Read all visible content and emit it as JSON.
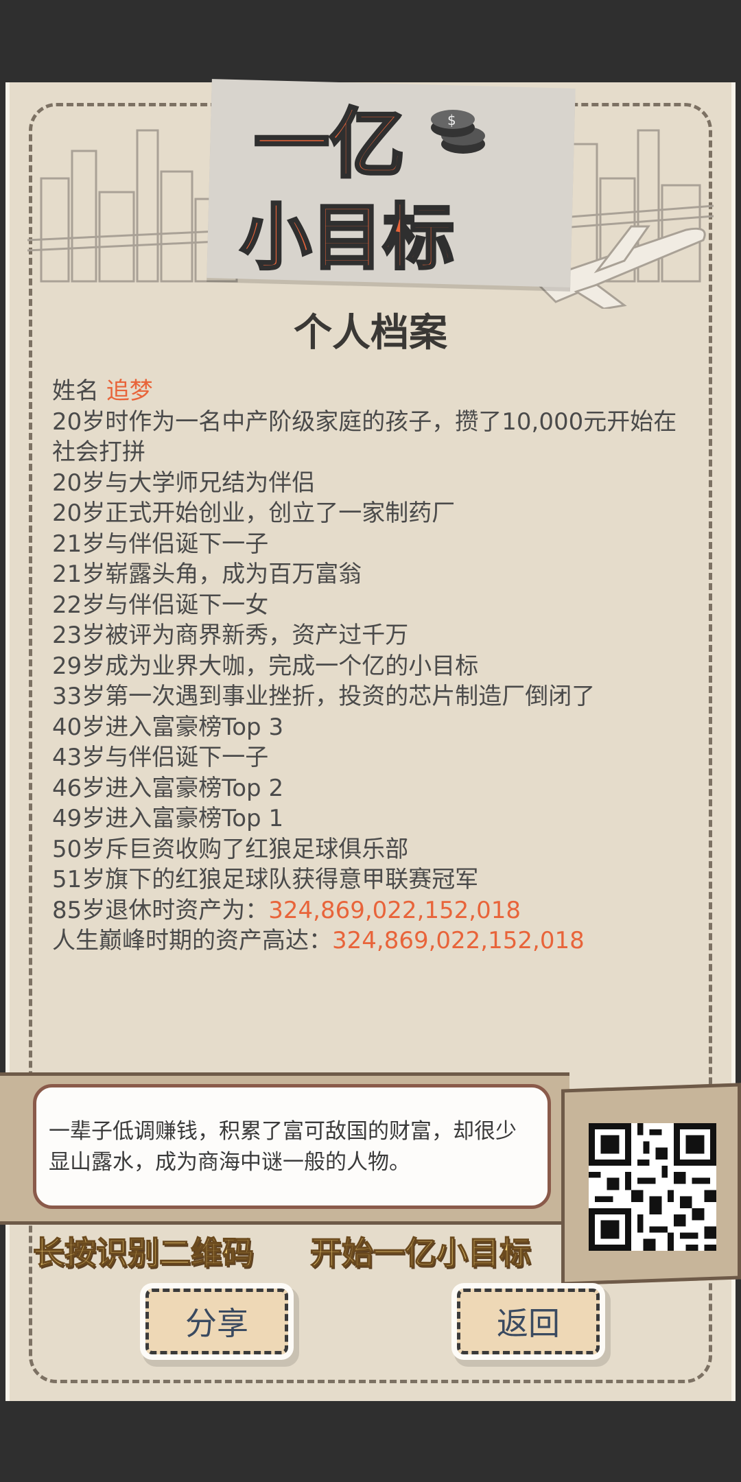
{
  "logo": {
    "line1": "一亿",
    "line2": "小目标"
  },
  "page_title": "个人档案",
  "profile": {
    "name_label": "姓名",
    "name_value": "追梦",
    "events": [
      "20岁时作为一名中产阶级家庭的孩子，攒了10,000元开始在社会打拼",
      "20岁与大学师兄结为伴侣",
      "20岁正式开始创业，创立了一家制药厂",
      "21岁与伴侣诞下一子",
      "21岁崭露头角，成为百万富翁",
      "22岁与伴侣诞下一女",
      "23岁被评为商界新秀，资产过千万",
      "29岁成为业界大咖，完成一个亿的小目标",
      "33岁第一次遇到事业挫折，投资的芯片制造厂倒闭了",
      "40岁进入富豪榜Top 3",
      "43岁与伴侣诞下一子",
      "46岁进入富豪榜Top 2",
      "49岁进入富豪榜Top 1",
      "50岁斥巨资收购了红狼足球俱乐部",
      "51岁旗下的红狼足球队获得意甲联赛冠军"
    ],
    "retire_label": "85岁退休时资产为：",
    "retire_value": "324,869,022,152,018",
    "peak_label": "人生巅峰时期的资产高达：",
    "peak_value": "324,869,022,152,018"
  },
  "quote": "一辈子低调赚钱，积累了富可敌国的财富，却很少显山露水，成为商海中谜一般的人物。",
  "cta_left": "长按识别二维码",
  "cta_right": "开始一亿小目标",
  "buttons": {
    "share": "分享",
    "back": "返回"
  },
  "colors": {
    "accent": "#e8643a",
    "paper": "#e5dccb",
    "band": "#c7b59a"
  }
}
